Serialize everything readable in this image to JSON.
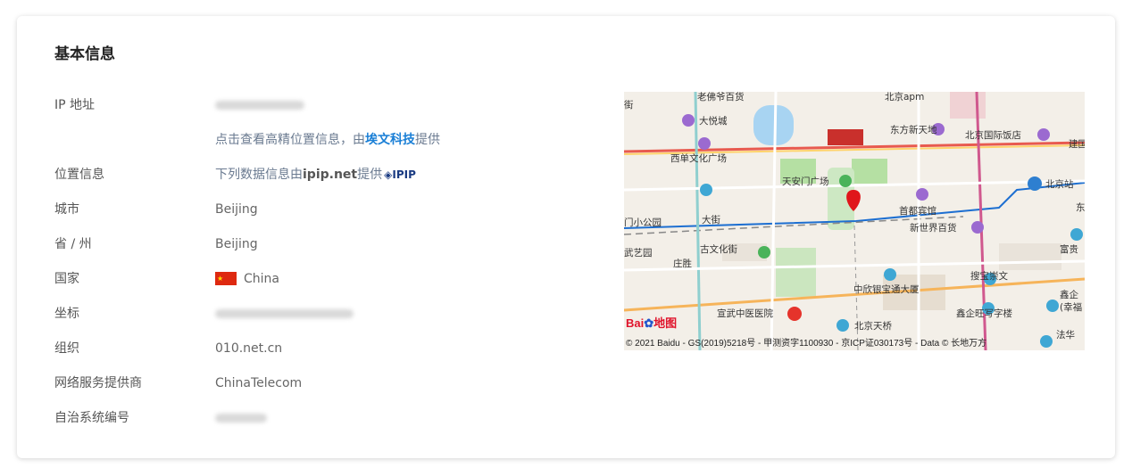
{
  "section_title": "基本信息",
  "rows": {
    "ip": {
      "label": "IP 地址"
    },
    "precise": {
      "prefix": "点击查看高精位置信息，由",
      "brand": "埃文科技",
      "suffix": "提供"
    },
    "location": {
      "label": "位置信息",
      "prefix": "下列数据信息由",
      "source": "ipip.net",
      "suffix": "提供",
      "logo": "IPIP"
    },
    "city": {
      "label": "城市",
      "value": "Beijing"
    },
    "province": {
      "label": "省 / 州",
      "value": "Beijing"
    },
    "country": {
      "label": "国家",
      "value": "China",
      "flag": "china-flag"
    },
    "coords": {
      "label": "坐标"
    },
    "org": {
      "label": "组织",
      "value": "010.net.cn"
    },
    "isp": {
      "label": "网络服务提供商",
      "value": "ChinaTelecom"
    },
    "asn": {
      "label": "自治系统编号"
    }
  },
  "map": {
    "logo_text": "Bai",
    "logo_suffix": "地图",
    "copyright": "© 2021 Baidu - GS(2019)5218号 - 甲测资字1100930 - 京ICP证030173号 - Data © 长地万方",
    "labels": {
      "dayuecheng": "大悦城",
      "dongfang": "东方新天地",
      "guojifandian": "北京国际饭店",
      "xidan": "西单文化广场",
      "tiananmen": "天安门广场",
      "beijingzhan": "北京站",
      "xiaogongyuan": "门小公园",
      "dajie": "大街",
      "shoudu": "首都宾馆",
      "xinshijie": "新世界百货",
      "wuyiyuan": "武艺园",
      "wenhuajie": "古文化街",
      "zhuangsheng": "庄胜",
      "soubao": "搜宝崇文",
      "zhongxin": "中欣银宝通大厦",
      "fugui": "富贵",
      "xuanwu": "宣武中医医院",
      "tianqiao": "北京天桥",
      "xinqi": "鑫企旺写字楼",
      "xinqi2": "鑫企",
      "xing": "(幸福",
      "fafa": "法华",
      "top1": "老佛爷百货",
      "top2": "北京apm",
      "jianguo": "建国",
      "dong": "东",
      "jie": "街"
    },
    "marker_color": "#e0161b"
  }
}
